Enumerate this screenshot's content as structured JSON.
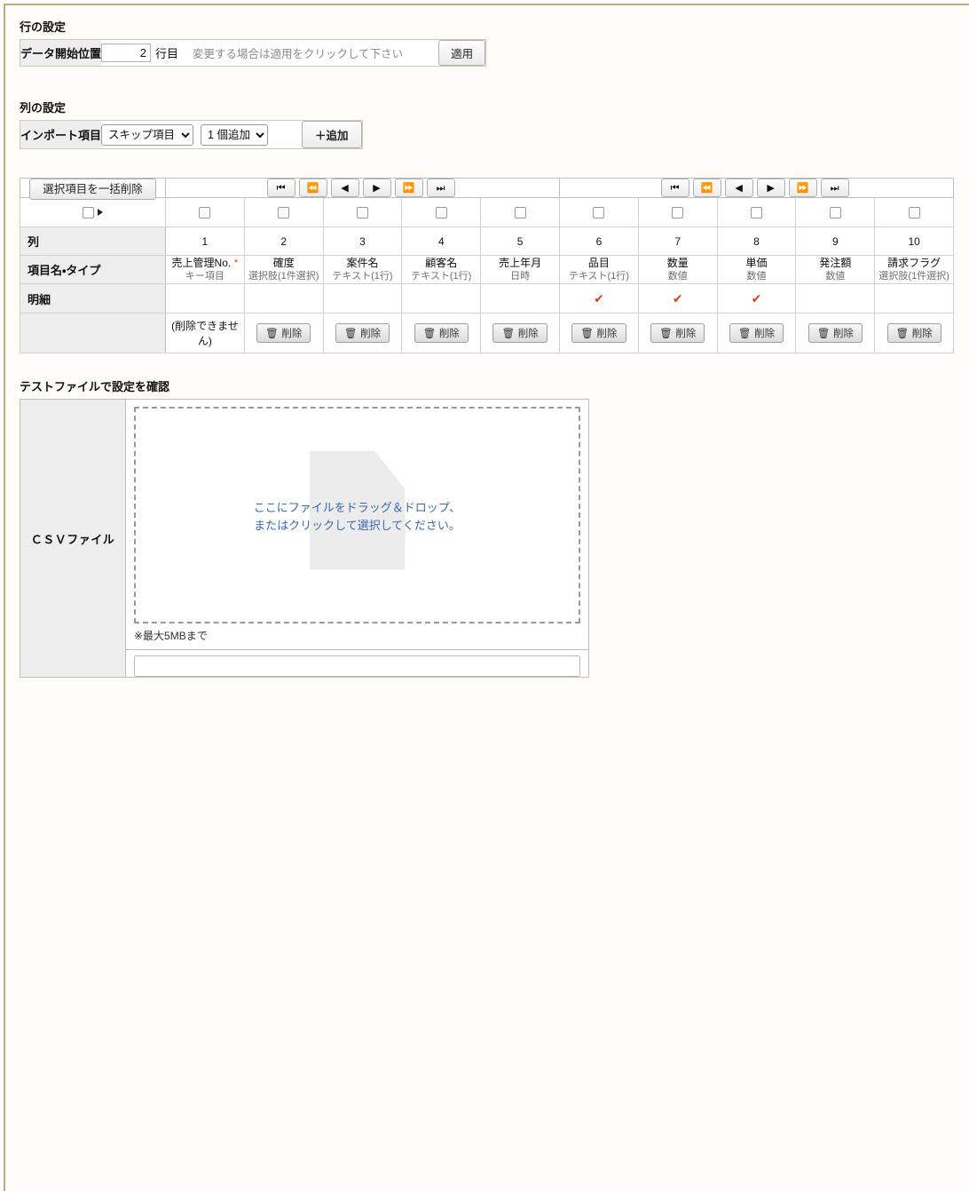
{
  "row_settings": {
    "section_title": "行の設定",
    "label": "データ開始位置",
    "start_row_value": "2",
    "unit": "行目",
    "hint": "変更する場合は適用をクリックして下さい",
    "apply_button": "適用"
  },
  "column_settings": {
    "section_title": "列の設定",
    "label": "インポート項目",
    "type_select_value": "スキップ項目",
    "type_select_options": [
      "スキップ項目"
    ],
    "count_select_value": "1 個追加",
    "count_select_options": [
      "1 個追加"
    ],
    "add_button": "＋追加"
  },
  "mapping_table": {
    "delete_selected_button": "選択項目を一括削除",
    "nav_buttons": [
      {
        "name": "first",
        "glyph": "⏮"
      },
      {
        "name": "fast-backward",
        "glyph": "⏪"
      },
      {
        "name": "previous",
        "glyph": "◀"
      },
      {
        "name": "next",
        "glyph": "▶"
      },
      {
        "name": "fast-forward",
        "glyph": "⏩"
      },
      {
        "name": "last",
        "glyph": "⏭"
      }
    ],
    "row_labels": {
      "column": "列",
      "field": "項目名・タイプ",
      "detail": "明細"
    },
    "no_delete_text": "(削除できません)",
    "delete_button": "削除",
    "delete_icon": "trash-icon",
    "required_marker": "*",
    "detail_check_glyph": "✔",
    "check_color": "#d4441a",
    "columns": [
      {
        "number": "1",
        "field": "売上管理No.",
        "required": true,
        "type": "キー項目",
        "detail": false,
        "deletable": false
      },
      {
        "number": "2",
        "field": "確度",
        "required": false,
        "type": "選択肢(1件選択)",
        "detail": false,
        "deletable": true
      },
      {
        "number": "3",
        "field": "案件名",
        "required": false,
        "type": "テキスト(1行)",
        "detail": false,
        "deletable": true
      },
      {
        "number": "4",
        "field": "顧客名",
        "required": false,
        "type": "テキスト(1行)",
        "detail": false,
        "deletable": true
      },
      {
        "number": "5",
        "field": "売上年月",
        "required": false,
        "type": "日時",
        "detail": false,
        "deletable": true
      },
      {
        "number": "6",
        "field": "品目",
        "required": false,
        "type": "テキスト(1行)",
        "detail": true,
        "deletable": true
      },
      {
        "number": "7",
        "field": "数量",
        "required": false,
        "type": "数値",
        "detail": true,
        "deletable": true
      },
      {
        "number": "8",
        "field": "単価",
        "required": false,
        "type": "数値",
        "detail": true,
        "deletable": true
      },
      {
        "number": "9",
        "field": "発注額",
        "required": false,
        "type": "数値",
        "detail": false,
        "deletable": true
      },
      {
        "number": "10",
        "field": "請求フラグ",
        "required": false,
        "type": "選択肢(1件選択)",
        "detail": false,
        "deletable": true
      }
    ]
  },
  "test_file": {
    "section_title": "テストファイルで設定を確認",
    "csv_label": "ＣＳＶファイル",
    "dropzone_line1": "ここにファイルをドラッグ＆ドロップ、",
    "dropzone_line2": "またはクリックして選択してください。",
    "max_note": "※最大5MBまで"
  }
}
